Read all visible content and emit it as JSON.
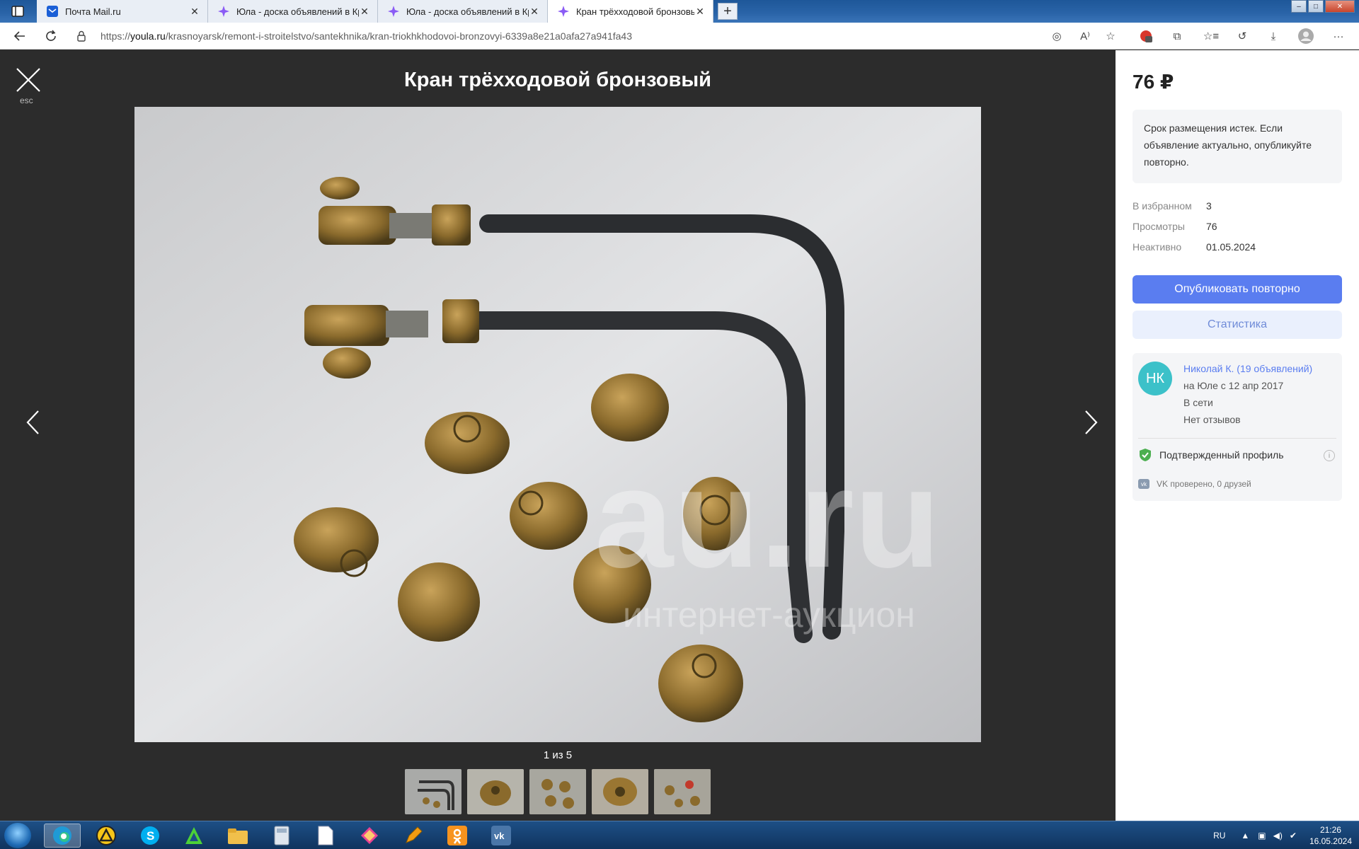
{
  "browser": {
    "tabs": [
      {
        "title": "Почта Mail.ru",
        "icon": "mail-icon",
        "active": false
      },
      {
        "title": "Юла - доска объявлений в Кр",
        "icon": "youla-icon",
        "active": false
      },
      {
        "title": "Юла - доска объявлений в Кр",
        "icon": "youla-icon",
        "active": false
      },
      {
        "title": "Кран трёхходовой бронзовый",
        "icon": "youla-icon",
        "active": true
      }
    ],
    "url_prefix": "https://",
    "url_host": "youla.ru",
    "url_path": "/krasnoyarsk/remont-i-stroitelstvo/santekhnika/kran-triokhkhodovoi-bronzovyi-6339a8e21a0afa27a941fa43"
  },
  "gallery": {
    "title": "Кран трёхходовой бронзовый",
    "esc_label": "esc",
    "counter": "1 из 5",
    "watermark_main": "au.ru",
    "watermark_sub": "интернет-аукцион",
    "thumbnail_count": 5
  },
  "panel": {
    "price": "76 ₽",
    "notice": "Срок размещения истек. Если объявление актуально, опубликуйте повторно.",
    "stats": [
      {
        "label": "В избранном",
        "value": "3"
      },
      {
        "label": "Просмотры",
        "value": "76"
      },
      {
        "label": "Неактивно",
        "value": "01.05.2024"
      }
    ],
    "republish_button": "Опубликовать повторно",
    "stats_button": "Статистика",
    "seller": {
      "initials": "НК",
      "name": "Николай К. (19 объявлений)",
      "since": "на Юле с 12 апр 2017",
      "online": "В сети",
      "reviews": "Нет отзывов",
      "verified": "Подтвержденный профиль",
      "vk": "VK проверено, 0 друзей"
    }
  },
  "taskbar": {
    "lang": "RU",
    "time": "21:26",
    "date": "16.05.2024"
  },
  "colors": {
    "accent": "#5a7df0",
    "avatar": "#3cc1c9",
    "verified": "#4caf50"
  }
}
